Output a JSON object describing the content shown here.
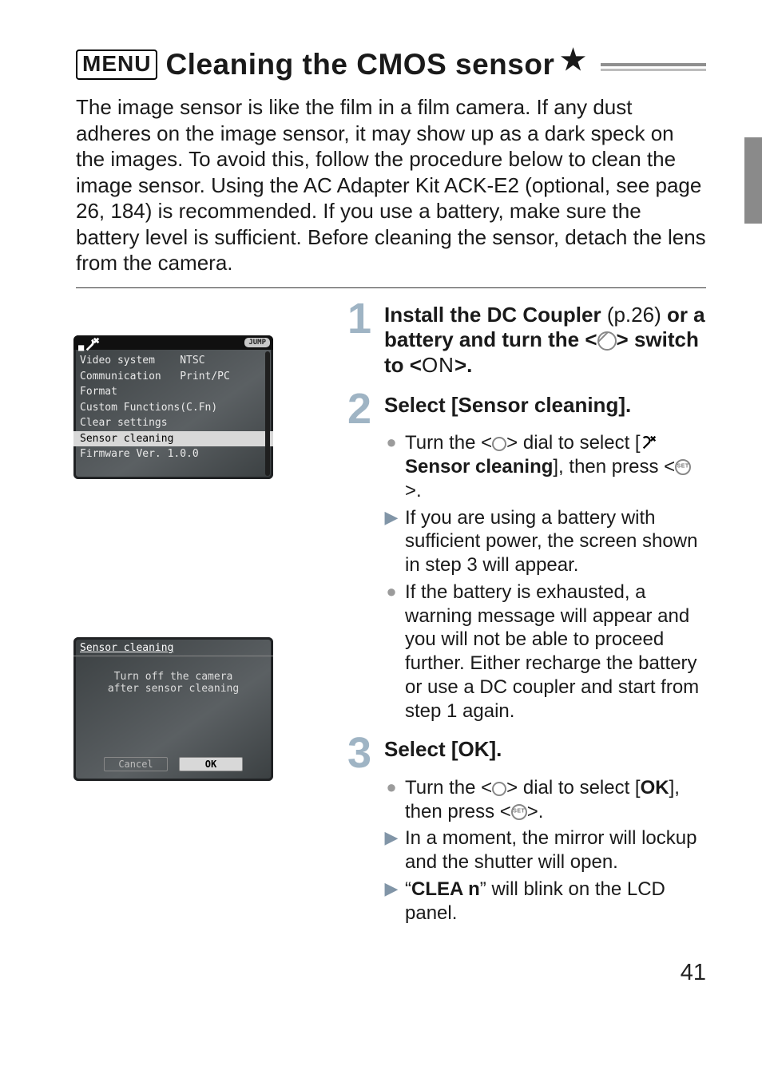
{
  "page_number": "41",
  "title": {
    "badge": "MENU",
    "text": "Cleaning the CMOS sensor",
    "star": "★"
  },
  "intro": "The image sensor is like the film in a film camera. If any dust adheres on the image sensor, it may show up as a dark speck on the images. To avoid this, follow the procedure below to clean the image sensor. Using the AC Adapter Kit ACK-E2 (optional, see page 26, 184) is recommended. If you use a battery, make sure the battery level is sufficient. Before cleaning the sensor, detach the lens from the camera.",
  "steps": {
    "s1": {
      "num": "1",
      "title_pre": "Install the DC Coupler ",
      "title_mid_thin": "(p.26)",
      "title_mid2": " or a battery and turn the <",
      "title_after": "> switch to <",
      "title_on": "ON",
      "title_end": ">."
    },
    "s2": {
      "num": "2",
      "title": "Select [Sensor cleaning].",
      "a_pre": "Turn the <",
      "a_mid": "> dial to select [",
      "a_label": " Sensor cleaning",
      "a_mid2": "], then press <",
      "a_end": ">.",
      "b": "If you are using a battery with sufficient power, the screen shown in step 3 will appear.",
      "c": "If the battery is exhausted, a warning message will appear and you will not be able to proceed further. Either recharge the battery or use a DC coupler and start from step 1 again."
    },
    "s3": {
      "num": "3",
      "title": "Select [OK].",
      "a_pre": "Turn the <",
      "a_mid": "> dial to select [",
      "a_ok": "OK",
      "a_mid2": "], then press <",
      "a_end": ">.",
      "b": "In a moment, the mirror will lockup and the shutter will open.",
      "c_pre": "“",
      "c_bold": "CLEA n",
      "c_post": "” will blink on the LCD panel."
    }
  },
  "lcd1": {
    "tab_icon": "■",
    "jump_label": "JUMP",
    "items": [
      "Video system    NTSC",
      "Communication   Print/PC",
      "Format",
      "Custom Functions(C.Fn)",
      "Clear settings",
      "Sensor cleaning",
      "Firmware Ver. 1.0.0"
    ],
    "selected_index": 5
  },
  "lcd2": {
    "header": "Sensor cleaning",
    "message": "Turn off the camera\nafter sensor cleaning",
    "cancel": "Cancel",
    "ok": "OK"
  }
}
